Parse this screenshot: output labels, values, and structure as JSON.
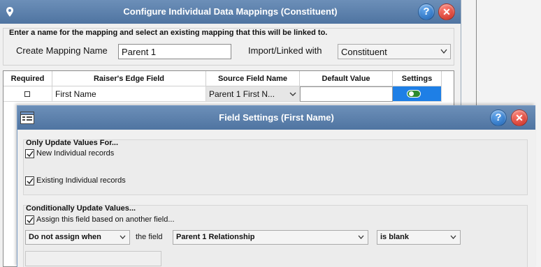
{
  "bg_dialog": {
    "title": "Configure Individual Data Mappings (Constituent)",
    "instructions": "Enter a name for the mapping and select an existing mapping that this will be linked to.",
    "create_label": "Create Mapping Name",
    "create_value": "Parent 1",
    "import_label": "Import/Linked with",
    "import_value": "Constituent",
    "grid": {
      "headers": [
        "Required",
        "Raiser's Edge Field",
        "Source Field Name",
        "Default Value",
        "Settings"
      ],
      "rows": [
        {
          "required": false,
          "field": "First Name",
          "source": "Parent 1 First N...",
          "default": ""
        }
      ]
    }
  },
  "fg_dialog": {
    "title": "Field Settings (First Name)",
    "group1": {
      "title": "Only Update Values For...",
      "options": [
        {
          "label": "New Individual records",
          "checked": true
        },
        {
          "label": "Existing Individual records",
          "checked": true
        }
      ]
    },
    "group2": {
      "title": "Conditionally Update Values...",
      "assign_label": "Assign this field based on another field...",
      "assign_checked": true,
      "condition_action": "Do not assign when",
      "the_field_label": "the field",
      "field_value": "Parent 1 Relationship",
      "operator_value": "is blank",
      "compare_value": ""
    }
  },
  "colors": {
    "title_bar": "#5a7fad",
    "selected_cell": "#1e7fe6",
    "toggle_on": "#2e8b2e"
  }
}
